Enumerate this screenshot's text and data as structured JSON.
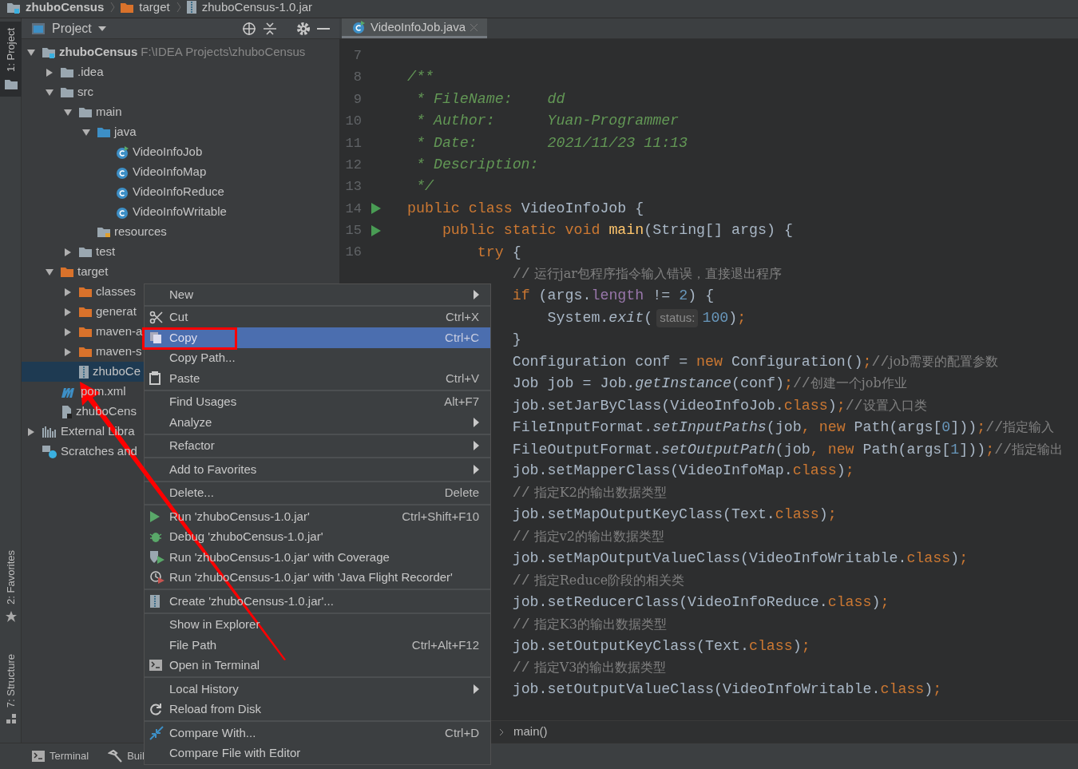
{
  "breadcrumb": [
    {
      "label": "zhuboCensus",
      "kind": "module"
    },
    {
      "label": "target",
      "kind": "folder-excluded"
    },
    {
      "label": "zhuboCensus-1.0.jar",
      "kind": "jar"
    }
  ],
  "left_tool_windows_top": [
    {
      "label": "1: Project",
      "kind": "folder",
      "selected": true
    }
  ],
  "left_tool_windows_bottom": [
    {
      "label": "2: Favorites",
      "kind": "star",
      "selected": false
    },
    {
      "label": "7: Structure",
      "kind": "structure",
      "selected": false
    }
  ],
  "project_panel": {
    "title": "Project",
    "tree": [
      {
        "label": "zhuboCensus",
        "path": "F:\\IDEA Projects\\zhuboCensus",
        "kind": "module",
        "expanded": true,
        "selected": false,
        "children": [
          {
            "label": ".idea",
            "kind": "folder",
            "expanded": false,
            "selected": false
          },
          {
            "label": "src",
            "kind": "folder",
            "expanded": true,
            "selected": false,
            "children": [
              {
                "label": "main",
                "kind": "folder",
                "expanded": true,
                "selected": false,
                "children": [
                  {
                    "label": "java",
                    "kind": "source-folder",
                    "expanded": true,
                    "selected": false,
                    "children": [
                      {
                        "label": "VideoInfoJob",
                        "kind": "class-run",
                        "selected": false
                      },
                      {
                        "label": "VideoInfoMap",
                        "kind": "class",
                        "selected": false
                      },
                      {
                        "label": "VideoInfoReduce",
                        "kind": "class",
                        "selected": false
                      },
                      {
                        "label": "VideoInfoWritable",
                        "kind": "class",
                        "selected": false
                      }
                    ]
                  },
                  {
                    "label": "resources",
                    "kind": "resources",
                    "selected": false
                  }
                ]
              },
              {
                "label": "test",
                "kind": "folder",
                "expanded": false,
                "selected": false
              }
            ]
          },
          {
            "label": "target",
            "kind": "folder-excluded",
            "expanded": true,
            "selected": false,
            "children": [
              {
                "label": "classes",
                "kind": "folder-excluded",
                "expanded": false,
                "selected": false
              },
              {
                "label": "generat",
                "kind": "folder-excluded",
                "expanded": false,
                "selected": false
              },
              {
                "label": "maven-a",
                "kind": "folder-excluded",
                "expanded": false,
                "selected": false
              },
              {
                "label": "maven-s",
                "kind": "folder-excluded",
                "expanded": false,
                "selected": false
              },
              {
                "label": "zhuboCe",
                "kind": "jar",
                "selected": true
              }
            ]
          },
          {
            "label": "pom.xml",
            "kind": "maven",
            "selected": false
          },
          {
            "label": "zhuboCens",
            "kind": "file",
            "selected": false
          }
        ]
      },
      {
        "label": "External Libra",
        "kind": "libraries",
        "expanded": false,
        "selected": false
      },
      {
        "label": "Scratches and",
        "kind": "scratches",
        "selected": false
      }
    ]
  },
  "editor": {
    "tabs": [
      {
        "label": "VideoInfoJob.java",
        "selected": true
      }
    ],
    "gutter": [
      {
        "number": "7",
        "runnable": false
      },
      {
        "number": "8",
        "runnable": false
      },
      {
        "number": "9",
        "runnable": false
      },
      {
        "number": "10",
        "runnable": false
      },
      {
        "number": "11",
        "runnable": false
      },
      {
        "number": "12",
        "runnable": false
      },
      {
        "number": "13",
        "runnable": false
      },
      {
        "number": "14",
        "runnable": true
      },
      {
        "number": "15",
        "runnable": true
      },
      {
        "number": "16",
        "runnable": false
      }
    ],
    "lines": [
      {
        "kind": "blank"
      },
      {
        "kind": "doc",
        "text": "/**"
      },
      {
        "kind": "doc",
        "text": " * FileName:    dd"
      },
      {
        "kind": "doc",
        "text": " * Author:      Yuan-Programmer"
      },
      {
        "kind": "doc",
        "text": " * Date:        2021/11/23 11:13"
      },
      {
        "kind": "doc",
        "text": " * Description:"
      },
      {
        "kind": "doc",
        "text": " */"
      },
      {
        "kind": "code",
        "text": "public class VideoInfoJob {"
      },
      {
        "kind": "code",
        "text": "    public static void main(String[] args) {"
      },
      {
        "kind": "code",
        "text": "        try {"
      },
      {
        "kind": "code",
        "text": "            // 运行jar包程序指令输入错误，直接退出程序"
      },
      {
        "kind": "code",
        "text": "            if (args.length != 2) {"
      },
      {
        "kind": "code",
        "text": "                System.exit(",
        "hint": "status:",
        "rest": "100);"
      },
      {
        "kind": "code",
        "text": "            }"
      },
      {
        "kind": "code",
        "text": "            Configuration conf = new Configuration();//job需要的配置参数"
      },
      {
        "kind": "code",
        "text": "            Job job = Job.getInstance(conf);//创建一个job作业"
      },
      {
        "kind": "code",
        "text": "            job.setJarByClass(VideoInfoJob.class);//设置入口类"
      },
      {
        "kind": "code",
        "text": "            FileInputFormat.setInputPaths(job, new Path(args[0]));//指定输入"
      },
      {
        "kind": "code",
        "text": "            FileOutputFormat.setOutputPath(job, new Path(args[1]));//指定输出"
      },
      {
        "kind": "code",
        "text": "            job.setMapperClass(VideoInfoMap.class);"
      },
      {
        "kind": "code",
        "text": "            // 指定K2的输出数据类型"
      },
      {
        "kind": "code",
        "text": "            job.setMapOutputKeyClass(Text.class);"
      },
      {
        "kind": "code",
        "text": "            // 指定v2的输出数据类型"
      },
      {
        "kind": "code",
        "text": "            job.setMapOutputValueClass(VideoInfoWritable.class);"
      },
      {
        "kind": "code",
        "text": "            // 指定Reduce阶段的相关类"
      },
      {
        "kind": "code",
        "text": "            job.setReducerClass(VideoInfoReduce.class);"
      },
      {
        "kind": "code",
        "text": "            // 指定K3的输出数据类型"
      },
      {
        "kind": "code",
        "text": "            job.setOutputKeyClass(Text.class);"
      },
      {
        "kind": "code",
        "text": "            // 指定V3的输出数据类型"
      },
      {
        "kind": "code",
        "text": "            job.setOutputValueClass(VideoInfoWritable.class);"
      }
    ],
    "code_breadcrumb": "main()"
  },
  "bottom_tool_windows": [
    {
      "label": "Terminal",
      "kind": "terminal"
    },
    {
      "label": "Buil",
      "kind": "hammer"
    }
  ],
  "context_menu": {
    "groups": [
      [
        {
          "label": "New",
          "submenu": true,
          "selected": false
        }
      ],
      [
        {
          "label": "Cut",
          "shortcut": "Ctrl+X",
          "kind": "cut",
          "selected": false
        },
        {
          "label": "Copy",
          "shortcut": "Ctrl+C",
          "kind": "copy",
          "selected": true
        },
        {
          "label": "Copy Path...",
          "selected": false
        },
        {
          "label": "Paste",
          "shortcut": "Ctrl+V",
          "kind": "paste",
          "selected": false
        }
      ],
      [
        {
          "label": "Find Usages",
          "shortcut": "Alt+F7",
          "selected": false
        },
        {
          "label": "Analyze",
          "submenu": true,
          "selected": false
        }
      ],
      [
        {
          "label": "Refactor",
          "submenu": true,
          "selected": false
        }
      ],
      [
        {
          "label": "Add to Favorites",
          "submenu": true,
          "selected": false
        }
      ],
      [
        {
          "label": "Delete...",
          "shortcut": "Delete",
          "selected": false
        }
      ],
      [
        {
          "label": "Run 'zhuboCensus-1.0.jar'",
          "shortcut": "Ctrl+Shift+F10",
          "kind": "run",
          "selected": false
        },
        {
          "label": "Debug 'zhuboCensus-1.0.jar'",
          "kind": "debug",
          "selected": false
        },
        {
          "label": "Run 'zhuboCensus-1.0.jar' with Coverage",
          "kind": "coverage",
          "selected": false
        },
        {
          "label": "Run 'zhuboCensus-1.0.jar' with 'Java Flight Recorder'",
          "kind": "profiler",
          "selected": false
        }
      ],
      [
        {
          "label": "Create 'zhuboCensus-1.0.jar'...",
          "kind": "jar",
          "selected": false
        }
      ],
      [
        {
          "label": "Show in Explorer",
          "selected": false
        },
        {
          "label": "File Path",
          "shortcut": "Ctrl+Alt+F12",
          "selected": false
        },
        {
          "label": "Open in Terminal",
          "kind": "terminal",
          "selected": false
        }
      ],
      [
        {
          "label": "Local History",
          "submenu": true,
          "selected": false
        },
        {
          "label": "Reload from Disk",
          "kind": "reload",
          "selected": false
        }
      ],
      [
        {
          "label": "Compare With...",
          "shortcut": "Ctrl+D",
          "kind": "compare",
          "selected": false
        },
        {
          "label": "Compare File with Editor",
          "selected": false
        }
      ]
    ]
  }
}
